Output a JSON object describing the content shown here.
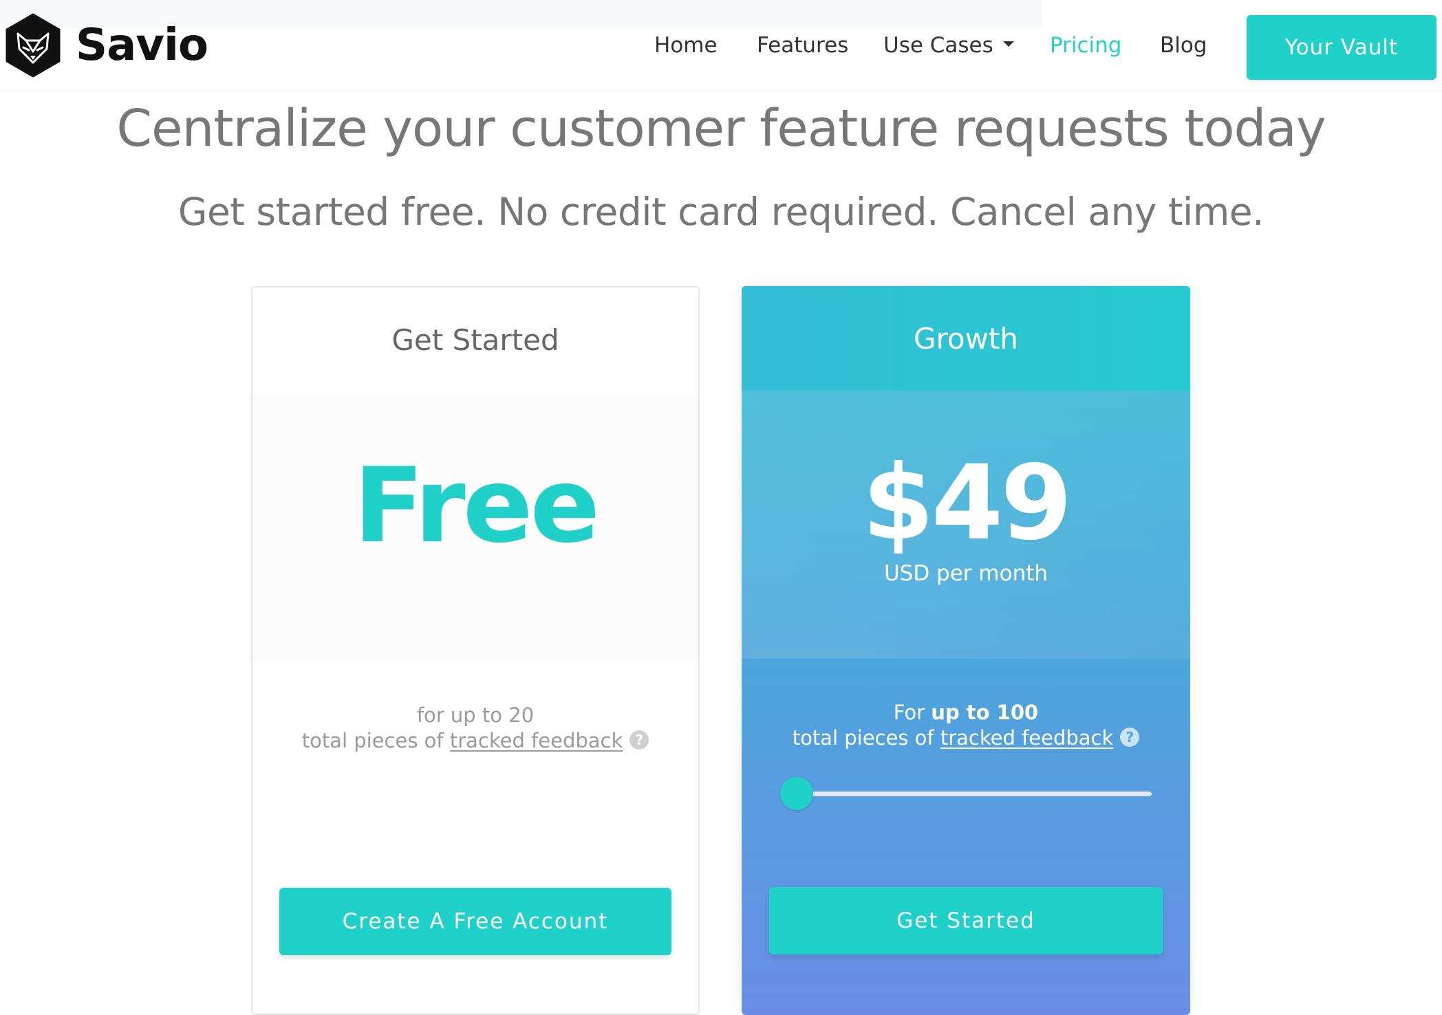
{
  "brand": {
    "name": "Savio",
    "colors": {
      "accent": "#1fd1c9",
      "heading_gray": "#777777",
      "nav_text": "#333333",
      "logo_black": "#111111",
      "growth_gradient_top": "#34bfd6",
      "growth_gradient_bottom": "#6a8ee6"
    }
  },
  "nav": {
    "items": [
      {
        "label": "Home",
        "active": false
      },
      {
        "label": "Features",
        "active": false
      },
      {
        "label": "Use Cases",
        "active": false,
        "has_dropdown": true,
        "dropdown_icon": "caret-down-icon"
      },
      {
        "label": "Pricing",
        "active": true
      },
      {
        "label": "Blog",
        "active": false
      }
    ],
    "cta_label": "Your Vault"
  },
  "hero": {
    "title": "Centralize your customer feature requests today",
    "subtitle": "Get started free. No credit card required. Cancel any time."
  },
  "plans": [
    {
      "name": "Get Started",
      "price": "Free",
      "description_line1": "for up to 20",
      "description_line2_prefix": "total pieces of ",
      "description_link": "tracked feedback",
      "help_icon": "question-circle-icon",
      "button_label": "Create A Free Account"
    },
    {
      "name": "Growth",
      "price": "$49",
      "period": "USD per month",
      "description_line1_prefix": "For ",
      "description_line1_bold": "up to 100",
      "description_line2_prefix": "total pieces of ",
      "description_link": "tracked feedback",
      "help_icon": "question-circle-icon",
      "slider_value_fraction": 0,
      "button_label": "Get Started"
    }
  ]
}
